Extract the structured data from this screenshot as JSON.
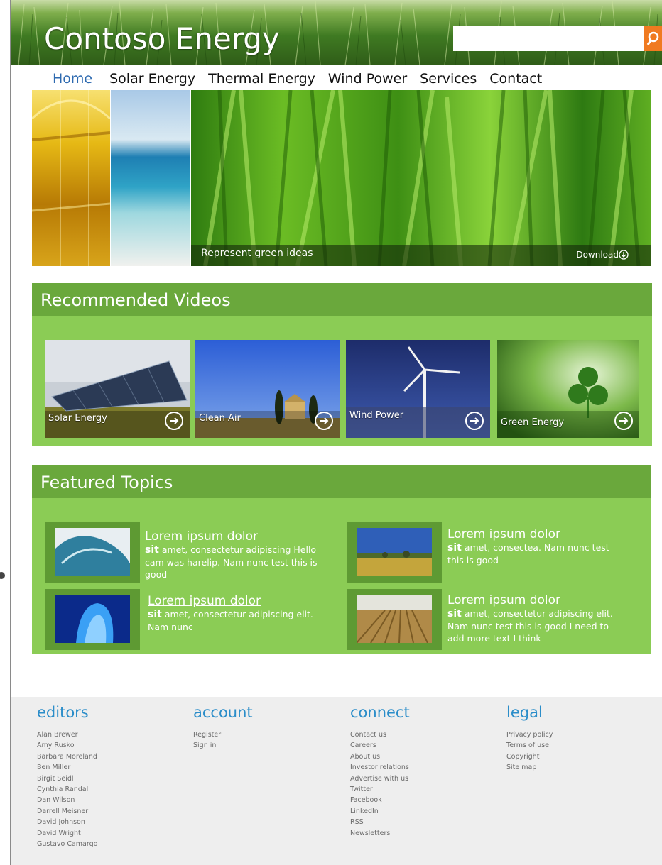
{
  "header": {
    "logo": "Contoso Energy",
    "search_placeholder": ""
  },
  "nav": [
    "Home",
    "Solar Energy",
    "Thermal Energy",
    "Wind Power",
    "Services",
    "Contact"
  ],
  "hero": {
    "caption": "Represent green ideas",
    "download": "Download"
  },
  "videos": {
    "title": "Recommended  Videos",
    "items": [
      "Solar Energy",
      "Clean Air",
      "Wind Power",
      "Green Energy"
    ]
  },
  "featured": {
    "title": "Featured  Topics",
    "items": [
      {
        "title": "Lorem ipsum dolor",
        "lead": "sit",
        "text": "amet, consectetur adipiscing Hello cam was harelip. Nam nunc test this is good"
      },
      {
        "title": "Lorem ipsum dolor",
        "lead": "sit",
        "text": "amet, consectea. Nam nunc test this is good"
      },
      {
        "title": "Lorem ipsum dolor",
        "lead": "sit",
        "text": "amet, consectetur adipiscing elit. Nam nunc"
      },
      {
        "title": "Lorem ipsum dolor",
        "lead": "sit",
        "text": "amet, consectetur adipiscing elit. Nam nunc test this is good I need to add more text I think"
      }
    ]
  },
  "footer": {
    "editors": {
      "title": "editors",
      "links": [
        "Alan Brewer",
        "Amy Rusko",
        "Barbara Moreland",
        "Ben Miller",
        "Birgit Seidl",
        "Cynthia Randall",
        "Dan Wilson",
        "Darrell Meisner",
        "David Johnson",
        "David Wright",
        "Gustavo Camargo"
      ]
    },
    "account": {
      "title": "account",
      "links": [
        "Register",
        "Sign in"
      ]
    },
    "connect": {
      "title": "connect",
      "links": [
        "Contact us",
        "Careers",
        "About us",
        "Investor relations",
        "Advertise with us",
        "Twitter",
        "Facebook",
        "LinkedIn",
        "RSS",
        "Newsletters"
      ]
    },
    "legal": {
      "title": "legal",
      "links": [
        "Privacy policy",
        "Terms of use",
        "Copyright",
        "Site map"
      ]
    }
  }
}
